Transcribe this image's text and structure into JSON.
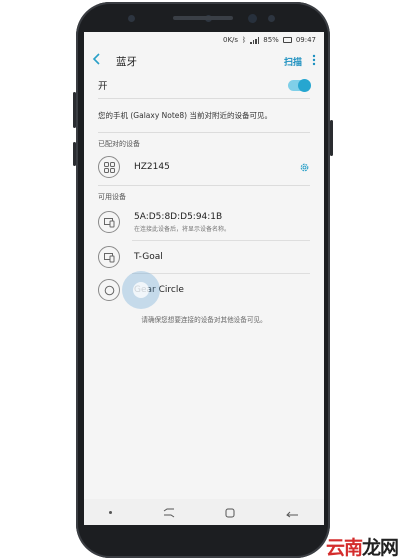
{
  "status_bar": {
    "speed": "0K/s",
    "battery": "85%",
    "time": "09:47"
  },
  "app_bar": {
    "title": "蓝牙",
    "scan_label": "扫描",
    "more_icon": "more-vertical-icon"
  },
  "bluetooth_toggle": {
    "label": "开",
    "state": "on",
    "accent_color": "#26a6d0"
  },
  "visibility_text": "您的手机 (Galaxy Note8) 当前对附近的设备可见。",
  "paired_section": {
    "header": "已配对的设备",
    "devices": [
      {
        "name": "HZ2145",
        "icon": "app-grid-icon",
        "settings_icon": "gear-icon"
      }
    ]
  },
  "available_section": {
    "header": "可用设备",
    "devices": [
      {
        "name": "5A:D5:8D:D5:94:1B",
        "subtitle": "在连接此设备后，将显示设备名称。",
        "icon": "devices-icon"
      },
      {
        "name": "T-Goal",
        "icon": "devices-icon"
      },
      {
        "name": "Gear Circle",
        "icon": "headset-icon"
      }
    ],
    "hint": "请确保您想要连接的设备对其他设备可见。"
  },
  "nav_bar": {
    "items": [
      "dot",
      "recent-apps-icon",
      "home-icon",
      "back-icon"
    ]
  },
  "watermark": {
    "part1": "云南",
    "part2": "龙网"
  }
}
